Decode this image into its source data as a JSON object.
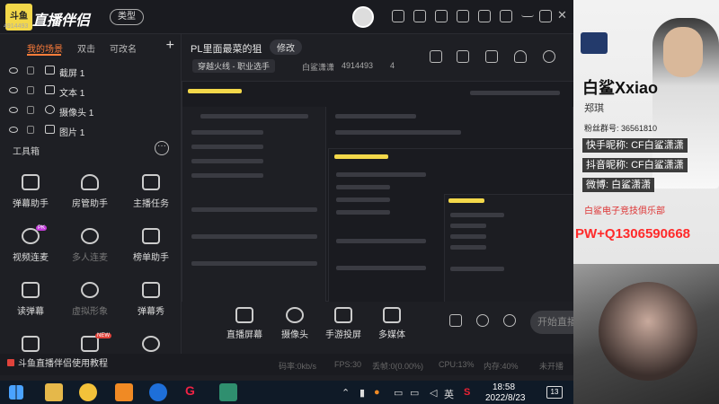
{
  "app": {
    "title": "直播伴侣",
    "type_button": "类型",
    "logo_text": "斗鱼",
    "logo_sub": "4914493"
  },
  "sidebar": {
    "tabs": [
      "我的场景",
      "双击",
      "可改名"
    ],
    "add": "+",
    "scene_items": [
      {
        "label": "截屏 1"
      },
      {
        "label": "文本 1"
      },
      {
        "label": "摄像头 1"
      },
      {
        "label": "图片 1"
      }
    ],
    "tools_header": "工具箱",
    "tools_more": "···",
    "tools": [
      {
        "label": "弹幕助手"
      },
      {
        "label": "房管助手"
      },
      {
        "label": "主播任务"
      },
      {
        "label": "视频连麦",
        "badge": "PK"
      },
      {
        "label": "多人连麦"
      },
      {
        "label": "榜单助手"
      },
      {
        "label": "读弹幕"
      },
      {
        "label": "虚拟形象"
      },
      {
        "label": "弹幕秀"
      },
      {
        "label": ""
      },
      {
        "label": "",
        "badge": "NEW"
      },
      {
        "label": ""
      }
    ],
    "help": "斗鱼直播伴侣使用教程"
  },
  "stream": {
    "title": "PL里面最菜的狙",
    "modify": "修改",
    "category": "穿越火线 - 职业选手",
    "streamer": "白鲨潇潇",
    "room_id": "4914493",
    "fans": "4"
  },
  "controls": [
    {
      "label": "直播屏幕"
    },
    {
      "label": "摄像头"
    },
    {
      "label": "手游投屏"
    },
    {
      "label": "多媒体"
    }
  ],
  "start_button": "开始直播",
  "status": {
    "bitrate": "码率:0kb/s",
    "fps": "FPS:30",
    "dropped": "丢帧:0(0.00%)",
    "cpu": "CPU:13%",
    "memory": "内存:40%",
    "not_started": "未开播"
  },
  "right_panel": {
    "name": "白鲨Xxiao",
    "cn_name": "郑琪",
    "fan_group": "粉丝群号: 36561810",
    "kuaishou": "快手昵称: CF白鲨潇潇",
    "douyin": "抖音昵称: CF白鲨潇潇",
    "weibo": "微博: 白鲨潇潇",
    "club": "白鲨电子竞技俱乐部",
    "ad": "PW+Q1306590668"
  },
  "taskbar": {
    "time": "18:58",
    "date": "2022/8/23",
    "notifications": "13",
    "ime": "英"
  }
}
